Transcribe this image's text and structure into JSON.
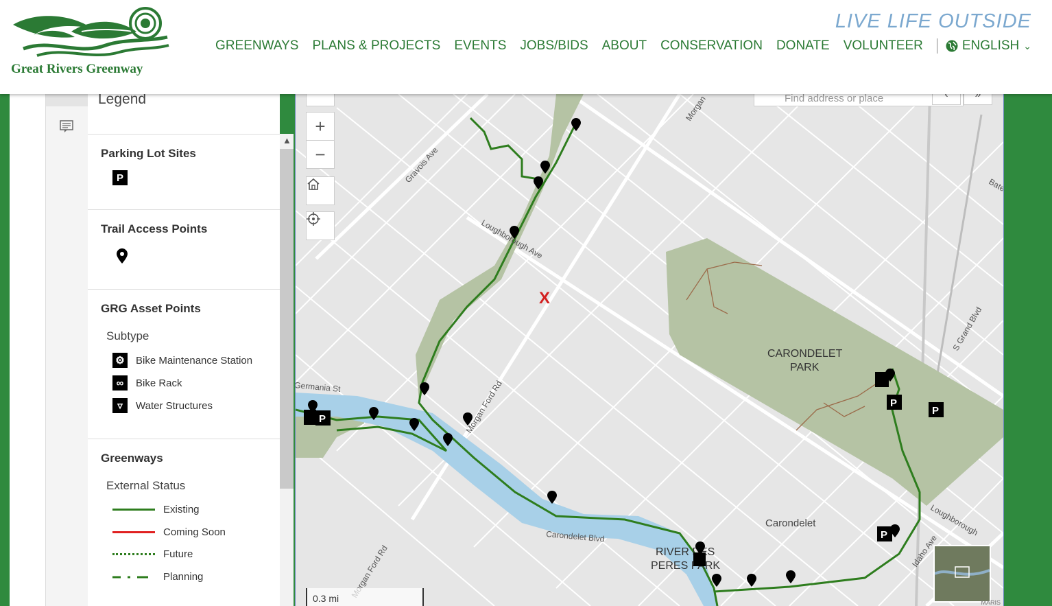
{
  "header": {
    "logo_text": "Great Rivers Greenway",
    "tagline": "LIVE LIFE OUTSIDE",
    "nav": [
      "GREENWAYS",
      "PLANS & PROJECTS",
      "EVENTS",
      "JOBS/BIDS",
      "ABOUT",
      "CONSERVATION",
      "DONATE",
      "VOLUNTEER"
    ],
    "language": "ENGLISH"
  },
  "legend": {
    "title": "Legend",
    "parking": {
      "title": "Parking Lot Sites",
      "symbol": "P"
    },
    "trail_access": {
      "title": "Trail Access Points"
    },
    "assets": {
      "title": "GRG Asset Points",
      "subhead": "Subtype",
      "items": [
        "Bike Maintenance Station",
        "Bike Rack",
        "Water Structures"
      ]
    },
    "greenways": {
      "title": "Greenways",
      "subhead": "External Status",
      "items": [
        {
          "label": "Existing",
          "color": "#2e7d1e",
          "style": "solid"
        },
        {
          "label": "Coming Soon",
          "color": "#e02020",
          "style": "solid"
        },
        {
          "label": "Future",
          "color": "#2e7d1e",
          "style": "dotted"
        },
        {
          "label": "Planning",
          "color": "#2e7d1e",
          "style": "dashdot"
        }
      ]
    }
  },
  "map": {
    "search_placeholder": "Find address or place",
    "scale": "0.3 mi",
    "labels": {
      "gravois": "Gravois Ave",
      "loughborough": "Loughborough Ave",
      "loughborough2": "Loughborough",
      "morgan": "Morgan",
      "morgan_ford": "Morgan Ford Rd",
      "morgan_ford2": "Morgan Ford Rd",
      "germania": "Germania St",
      "carondelet_blvd": "Carondelet Blvd",
      "carondelet": "Carondelet",
      "carondelet_park_1": "CARONDELET",
      "carondelet_park_2": "PARK",
      "rdp_1": "RIVER DES",
      "rdp_2": "PERES PARK",
      "grand": "S Grand Blvd",
      "idaho": "Idaho Ave",
      "bates": "Bates",
      "marker": "X",
      "attribution": "MARIS"
    }
  }
}
